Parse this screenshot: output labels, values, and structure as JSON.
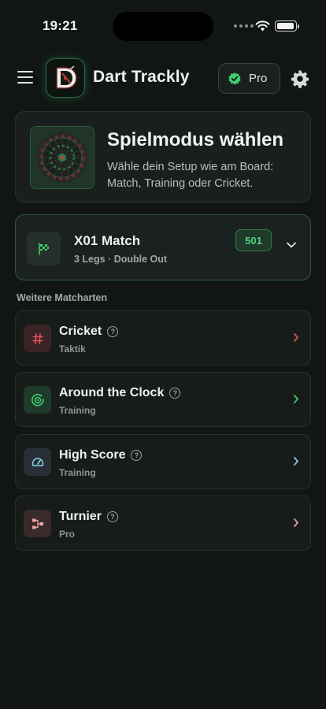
{
  "status": {
    "time": "19:21"
  },
  "header": {
    "app_title": "Dart Trackly",
    "pro_label": "Pro"
  },
  "hero": {
    "title": "Spielmodus wählen",
    "subtitle": "Wähle dein Setup wie am Board: Match, Training oder Cricket."
  },
  "x01": {
    "title": "X01 Match",
    "subtitle": "3 Legs · Double Out",
    "badge": "501"
  },
  "section_label": "Weitere Matcharten",
  "modes": [
    {
      "title": "Cricket",
      "subtitle": "Taktik",
      "icon": "hash-icon",
      "accent": "#e0525c"
    },
    {
      "title": "Around the Clock",
      "subtitle": "Training",
      "icon": "target-icon",
      "accent": "#3fcf72"
    },
    {
      "title": "High Score",
      "subtitle": "Training",
      "icon": "gauge-icon",
      "accent": "#8ad0e8"
    },
    {
      "title": "Turnier",
      "subtitle": "Pro",
      "icon": "bracket-icon",
      "accent": "#f0a4a4"
    }
  ],
  "colors": {
    "background": "#111614",
    "accent_green": "#4fd27f",
    "card": "#1a1f1d"
  }
}
